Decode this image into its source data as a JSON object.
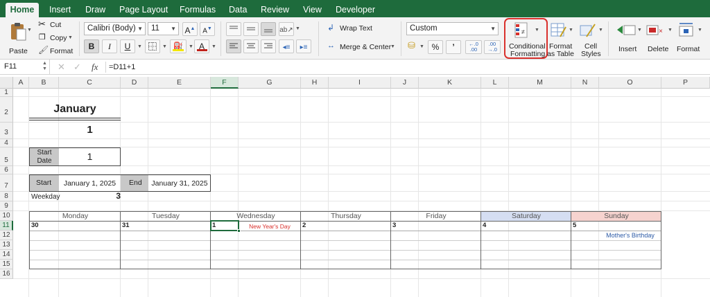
{
  "ribbon_tabs": [
    "Home",
    "Insert",
    "Draw",
    "Page Layout",
    "Formulas",
    "Data",
    "Review",
    "View",
    "Developer"
  ],
  "clipboard": {
    "paste": "Paste",
    "cut": "Cut",
    "copy": "Copy",
    "format": "Format"
  },
  "font": {
    "name": "Calibri (Body)",
    "size": "11",
    "bold": "B",
    "italic": "I",
    "underline": "U",
    "grow": "A",
    "shrink": "A",
    "color_letter": "A"
  },
  "alignment": {
    "wrap_text": "Wrap Text",
    "merge_center": "Merge & Center"
  },
  "number": {
    "format": "Custom",
    "percent": "%",
    "comma": "’"
  },
  "styles": {
    "conditional_line1": "Conditional",
    "conditional_line2": "Formatting",
    "format_table_line1": "Format",
    "format_table_line2": "as Table",
    "cell_styles_line1": "Cell",
    "cell_styles_line2": "Styles"
  },
  "cells_group": {
    "insert": "Insert",
    "delete": "Delete",
    "format": "Format"
  },
  "formula_bar": {
    "name_box": "F11",
    "fx": "fx",
    "formula": "=D11+1"
  },
  "columns": [
    "A",
    "B",
    "C",
    "D",
    "E",
    "F",
    "G",
    "H",
    "I",
    "J",
    "K",
    "L",
    "M",
    "N",
    "O",
    "P"
  ],
  "rows": [
    "1",
    "2",
    "3",
    "4",
    "5",
    "6",
    "7",
    "8",
    "9",
    "10",
    "11",
    "12",
    "13",
    "14",
    "15",
    "16"
  ],
  "sheet": {
    "month_title": "January",
    "month_number": "1",
    "start_date_label_1": "Start",
    "start_date_label_2": "Date",
    "start_date_value": "1",
    "start_label": "Start",
    "start_value": "January 1, 2025",
    "end_label": "End",
    "end_value": "January 31, 2025",
    "weekday_label": "Weekday",
    "weekday_value": "3",
    "days": [
      "Monday",
      "Tuesday",
      "Wednesday",
      "Thursday",
      "Friday",
      "Saturday",
      "Sunday"
    ],
    "dates": [
      "30",
      "31",
      "1",
      "2",
      "3",
      "4",
      "5"
    ],
    "holiday": "New Year's Day",
    "birthday": "Mother's Birthday"
  },
  "colors": {
    "accent": "#1e6b3c",
    "saturday": "#d5def2",
    "sunday": "#f6d3cf",
    "highlight": "#d9302c"
  }
}
